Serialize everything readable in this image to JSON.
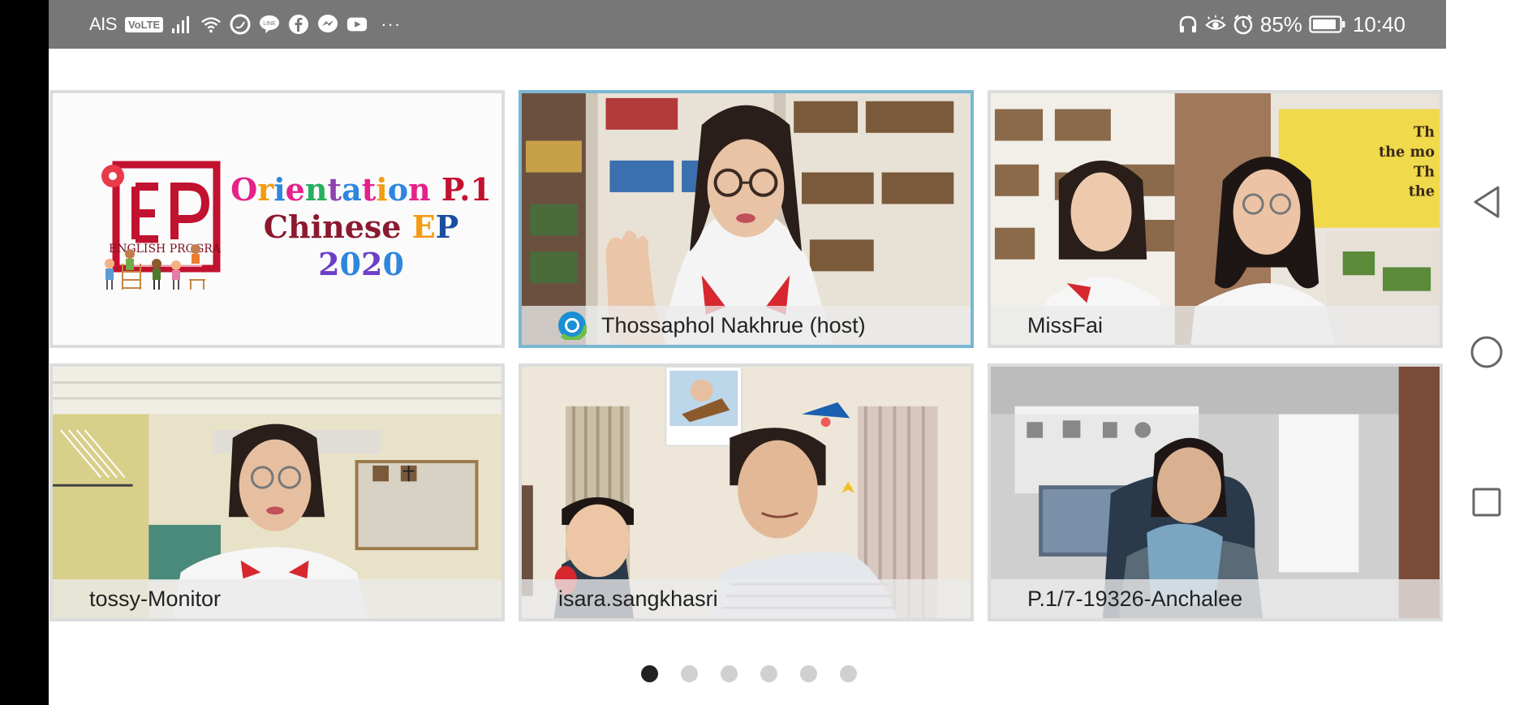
{
  "status_bar": {
    "carrier": "AIS",
    "volte": "VoLTE",
    "battery_percent": "85%",
    "time": "10:40",
    "overflow": "···",
    "left_icons": [
      "signal-icon",
      "wifi-icon",
      "chat-app-icon",
      "line-icon",
      "facebook-icon",
      "messenger-icon",
      "youtube-icon"
    ],
    "right_icons": [
      "headphones-icon",
      "eye-comfort-icon",
      "alarm-icon",
      "battery-icon"
    ]
  },
  "logo_tile": {
    "title_line1": "Orientation P.1",
    "title_line2": "Chinese EP",
    "title_line3": "2020",
    "badge_text": "ENGLISH PROGRA"
  },
  "participants": [
    {
      "name": "Thossaphol Nakhrue (host)",
      "is_host": true,
      "active": true
    },
    {
      "name": "MissFai",
      "is_host": false,
      "active": false
    },
    {
      "name": "tossy-Monitor",
      "is_host": false,
      "active": false
    },
    {
      "name": "isara.sangkhasri",
      "is_host": false,
      "active": false
    },
    {
      "name": "P.1/7-19326-Anchalee",
      "is_host": false,
      "active": false
    }
  ],
  "pager": {
    "pages": 6,
    "current": 1
  },
  "colors": {
    "status_bar": "#777777",
    "active_border": "#7ab7d3",
    "brand_red": "#c1122f"
  }
}
